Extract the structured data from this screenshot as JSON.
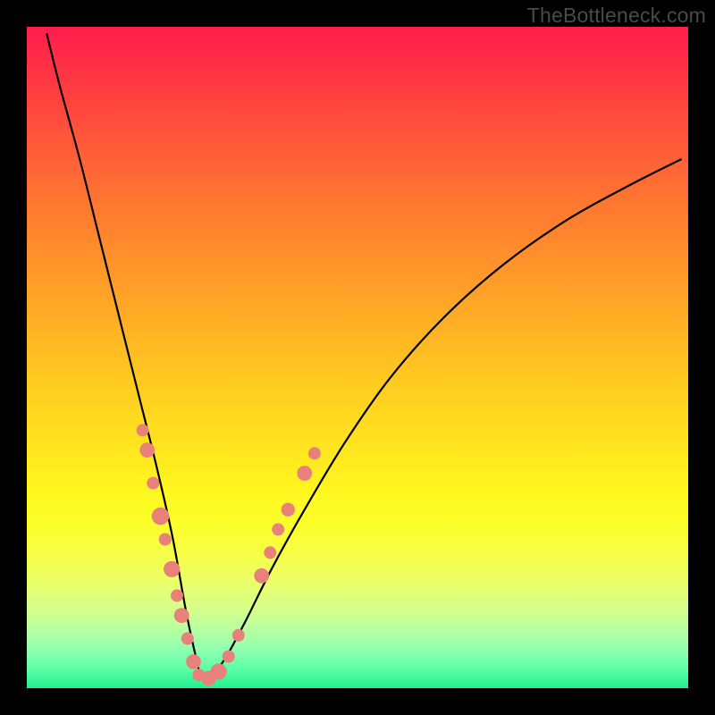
{
  "watermark": "TheBottleneck.com",
  "colors": {
    "dot": "#e9817b",
    "curve": "#000000",
    "frame": "#000000"
  },
  "chart_data": {
    "type": "line",
    "title": "",
    "xlabel": "",
    "ylabel": "",
    "xlim": [
      0,
      100
    ],
    "ylim": [
      0,
      100
    ],
    "note": "Axes are unlabeled; values are estimated from pixel positions. y=0 at bottom (green), y=100 at top (red). The curve is a V-shaped bottleneck profile with a minimum near x≈26.",
    "series": [
      {
        "name": "bottleneck-curve",
        "x": [
          3.0,
          5.0,
          8.0,
          11.0,
          14.0,
          17.0,
          19.5,
          22.0,
          24.0,
          25.5,
          26.5,
          28.0,
          30.0,
          33.0,
          37.0,
          42.0,
          48.0,
          55.0,
          63.0,
          72.0,
          82.0,
          92.0,
          99.0
        ],
        "y": [
          99.0,
          91.0,
          80.0,
          68.0,
          56.0,
          44.0,
          34.0,
          23.0,
          12.0,
          5.0,
          1.5,
          2.0,
          4.5,
          10.0,
          18.0,
          27.0,
          37.0,
          47.0,
          56.0,
          64.0,
          71.0,
          76.5,
          80.0
        ]
      }
    ],
    "scatter": {
      "name": "dots",
      "points": [
        {
          "x": 17.5,
          "y": 39.0,
          "r": 1.0
        },
        {
          "x": 18.2,
          "y": 36.0,
          "r": 1.2
        },
        {
          "x": 19.1,
          "y": 31.0,
          "r": 1.0
        },
        {
          "x": 20.2,
          "y": 26.0,
          "r": 1.4
        },
        {
          "x": 20.9,
          "y": 22.5,
          "r": 1.0
        },
        {
          "x": 21.9,
          "y": 18.0,
          "r": 1.3
        },
        {
          "x": 22.7,
          "y": 14.0,
          "r": 1.0
        },
        {
          "x": 23.4,
          "y": 11.0,
          "r": 1.2
        },
        {
          "x": 24.3,
          "y": 7.5,
          "r": 1.0
        },
        {
          "x": 25.2,
          "y": 4.0,
          "r": 1.2
        },
        {
          "x": 26.0,
          "y": 2.0,
          "r": 1.0
        },
        {
          "x": 27.5,
          "y": 1.5,
          "r": 1.2
        },
        {
          "x": 29.0,
          "y": 2.5,
          "r": 1.3
        },
        {
          "x": 30.5,
          "y": 4.8,
          "r": 1.0
        },
        {
          "x": 32.0,
          "y": 8.0,
          "r": 1.0
        },
        {
          "x": 35.5,
          "y": 17.0,
          "r": 1.2
        },
        {
          "x": 36.8,
          "y": 20.5,
          "r": 1.0
        },
        {
          "x": 38.0,
          "y": 24.0,
          "r": 1.0
        },
        {
          "x": 39.5,
          "y": 27.0,
          "r": 1.1
        },
        {
          "x": 42.0,
          "y": 32.5,
          "r": 1.2
        },
        {
          "x": 43.5,
          "y": 35.5,
          "r": 1.0
        }
      ]
    }
  }
}
